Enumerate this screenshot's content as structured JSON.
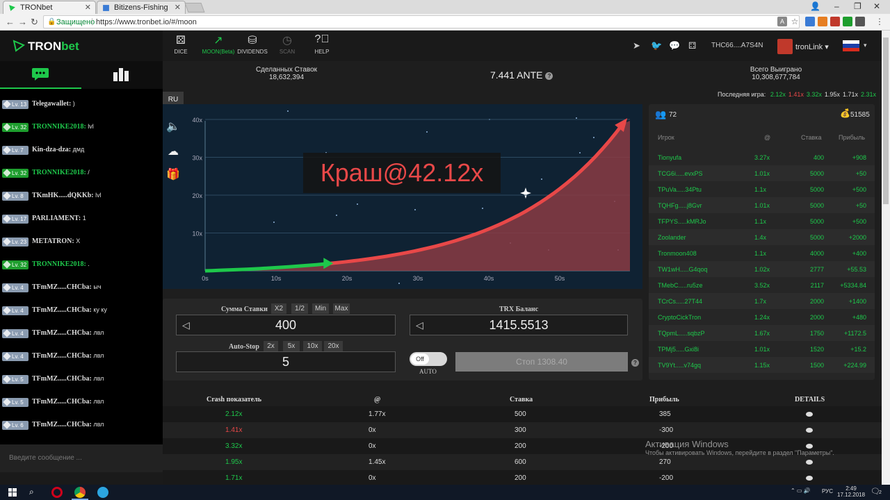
{
  "browser": {
    "tabs": [
      {
        "title": "TRONbet"
      },
      {
        "title": "Bitizens-Fishing"
      }
    ],
    "security_label": "Защищено",
    "url": "https://www.tronbet.io/#/moon"
  },
  "logo": {
    "tron": "TRON",
    "bet": "bet"
  },
  "nav": {
    "items": [
      {
        "label": "DICE",
        "icon": "dice-icon"
      },
      {
        "label": "MOON(Beta)",
        "icon": "moon-rocket-icon"
      },
      {
        "label": "DIVIDENDS",
        "icon": "coins-icon"
      },
      {
        "label": "SCAN",
        "icon": "clock-icon"
      },
      {
        "label": "HELP",
        "icon": "help-icon"
      }
    ],
    "address": "THC66....A7S4N",
    "tronlink": "tronLink ▾"
  },
  "stats": {
    "bets_label": "Сделанных Ставок",
    "bets_value": "18,632,394",
    "ante": "7.441 ANTE",
    "won_label": "Всего Выиграно",
    "won_value": "10,308,677,784",
    "last_game_label": "Последняя игра:",
    "last_games": [
      {
        "v": "2.12x",
        "color": "#1ec84b"
      },
      {
        "v": "1.41x",
        "color": "#e84848"
      },
      {
        "v": "3.32x",
        "color": "#1ec84b"
      },
      {
        "v": "1.95x",
        "color": "#ddd"
      },
      {
        "v": "1.71x",
        "color": "#ddd"
      },
      {
        "v": "2.31x",
        "color": "#1ec84b"
      }
    ]
  },
  "game": {
    "lang": "RU",
    "crash_text": "Краш@42.12x",
    "x_ticks": [
      "0s",
      "10s",
      "20s",
      "30s",
      "40s",
      "50s"
    ],
    "y_ticks": [
      "40x",
      "30x",
      "20x",
      "10x"
    ]
  },
  "bet": {
    "amount_label": "Сумма Ставки",
    "amount_buttons": [
      "X2",
      "1/2",
      "Min",
      "Max"
    ],
    "amount_value": "400",
    "balance_label": "TRX Баланс",
    "balance_value": "1415.5513",
    "autostop_label": "Auto-Stop",
    "autostop_buttons": [
      "2x",
      "5x",
      "10x",
      "20x"
    ],
    "autostop_value": "5",
    "toggle_label": "Off",
    "auto_label": "AUTO",
    "stop_button": "Стоп 1308.40"
  },
  "players": {
    "count": "72",
    "total": "51585",
    "headers": [
      "Игрок",
      "@",
      "Ставка",
      "Прибыль"
    ],
    "rows": [
      {
        "name": "Tionyufa",
        "at": "3.27x",
        "bet": "400",
        "profit": "+908"
      },
      {
        "name": "TCG6i.....evxPS",
        "at": "1.01x",
        "bet": "5000",
        "profit": "+50"
      },
      {
        "name": "TPuVa.....34Ptu",
        "at": "1.1x",
        "bet": "5000",
        "profit": "+500"
      },
      {
        "name": "TQHFg.....j8Gvr",
        "at": "1.01x",
        "bet": "5000",
        "profit": "+50"
      },
      {
        "name": "TFPYS.....kMRJo",
        "at": "1.1x",
        "bet": "5000",
        "profit": "+500"
      },
      {
        "name": "Zoolander",
        "at": "1.4x",
        "bet": "5000",
        "profit": "+2000"
      },
      {
        "name": "Tronmoon408",
        "at": "1.1x",
        "bet": "4000",
        "profit": "+400"
      },
      {
        "name": "TW1wH.....G4qoq",
        "at": "1.02x",
        "bet": "2777",
        "profit": "+55.53"
      },
      {
        "name": "TMebC.....ru5ze",
        "at": "3.52x",
        "bet": "2117",
        "profit": "+5334.84"
      },
      {
        "name": "TCrCs.....27T44",
        "at": "1.7x",
        "bet": "2000",
        "profit": "+1400"
      },
      {
        "name": "CryptoCickTron",
        "at": "1.24x",
        "bet": "2000",
        "profit": "+480"
      },
      {
        "name": "TQpmL.....sqbzP",
        "at": "1.67x",
        "bet": "1750",
        "profit": "+1172.5"
      },
      {
        "name": "TPMj5.....Gxi8i",
        "at": "1.01x",
        "bet": "1520",
        "profit": "+15.2"
      },
      {
        "name": "TV9Yt.....v74gq",
        "at": "1.15x",
        "bet": "1500",
        "profit": "+224.99"
      }
    ]
  },
  "history": {
    "headers": [
      "Crash показатель",
      "@",
      "Ставка",
      "Прибыль",
      "DETAILS"
    ],
    "rows": [
      {
        "crash": "2.12x",
        "color": "#1ec84b",
        "at": "1.77x",
        "bet": "500",
        "profit": "385"
      },
      {
        "crash": "1.41x",
        "color": "#e84848",
        "at": "0x",
        "bet": "300",
        "profit": "-300"
      },
      {
        "crash": "3.32x",
        "color": "#1ec84b",
        "at": "0x",
        "bet": "200",
        "profit": "-200"
      },
      {
        "crash": "1.95x",
        "color": "#1ec84b",
        "at": "1.45x",
        "bet": "600",
        "profit": "270"
      },
      {
        "crash": "1.71x",
        "color": "#1ec84b",
        "at": "0x",
        "bet": "200",
        "profit": "-200"
      }
    ]
  },
  "chat": {
    "rows": [
      {
        "lv": "Lv. 13",
        "lvcolor": "gray",
        "name": "Telegawallet:",
        "msg": " )",
        "green": false
      },
      {
        "lv": "Lv. 32",
        "lvcolor": "green",
        "name": "TRONNIKE2018:",
        "msg": " lvl",
        "green": true
      },
      {
        "lv": "Lv. 7",
        "lvcolor": "gray",
        "name": "Kin-dza-dza:",
        "msg": " дмд",
        "green": false
      },
      {
        "lv": "Lv. 32",
        "lvcolor": "green",
        "name": "TRONNIKE2018:",
        "msg": " /",
        "green": true
      },
      {
        "lv": "Lv. 8",
        "lvcolor": "gray",
        "name": "TKmHK.....dQKKb:",
        "msg": " lvl",
        "green": false
      },
      {
        "lv": "Lv. 17",
        "lvcolor": "gray",
        "name": "PARLIAMENT:",
        "msg": " 1",
        "green": false
      },
      {
        "lv": "Lv. 23",
        "lvcolor": "gray",
        "name": "METATRON:",
        "msg": " X",
        "green": false
      },
      {
        "lv": "Lv. 32",
        "lvcolor": "green",
        "name": "TRONNIKE2018:",
        "msg": " .",
        "green": true
      },
      {
        "lv": "Lv. 4",
        "lvcolor": "gray",
        "name": "TFmMZ.....CHCba:",
        "msg": " ыч",
        "green": false
      },
      {
        "lv": "Lv. 4",
        "lvcolor": "gray",
        "name": "TFmMZ.....CHCba:",
        "msg": " ку ку",
        "green": false
      },
      {
        "lv": "Lv. 4",
        "lvcolor": "gray",
        "name": "TFmMZ.....CHCba:",
        "msg": " лвл",
        "green": false
      },
      {
        "lv": "Lv. 4",
        "lvcolor": "gray",
        "name": "TFmMZ.....CHCba:",
        "msg": " лвл",
        "green": false
      },
      {
        "lv": "Lv. 5",
        "lvcolor": "gray",
        "name": "TFmMZ.....CHCba:",
        "msg": " лвл",
        "green": false
      },
      {
        "lv": "Lv. 5",
        "lvcolor": "gray",
        "name": "TFmMZ.....CHCba:",
        "msg": " лвл",
        "green": false
      },
      {
        "lv": "Lv. 6",
        "lvcolor": "gray",
        "name": "TFmMZ.....CHCba:",
        "msg": " лвл",
        "green": false
      }
    ],
    "input_placeholder": "Введите сообщение ..."
  },
  "windows": {
    "watermark_title": "Активация Windows",
    "watermark_text": "Чтобы активировать Windows, перейдите в раздел \"Параметры\".",
    "lang": "РУС",
    "time": "2:49",
    "date": "17.12.2018",
    "notif_count": "2"
  },
  "colors": {
    "accent": "#1ec84b",
    "danger": "#e84848",
    "chart_bg": "#0f2233"
  }
}
